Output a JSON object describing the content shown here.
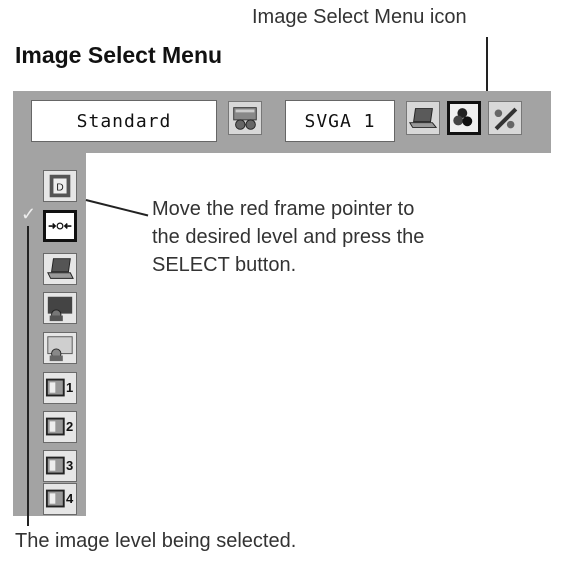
{
  "callouts": {
    "menu_icon": "Image Select Menu icon",
    "instruction_lines": [
      "Move the red frame pointer to",
      "the desired level and press the",
      "SELECT button."
    ],
    "level_selected": "The image level being selected."
  },
  "section_title": "Image Select Menu",
  "toolbar": {
    "mode_label": "Standard",
    "signal_label": "SVGA 1",
    "icons": [
      "projector-settings-icon",
      "laptop-icon",
      "image-select-icon",
      "pen-icon"
    ],
    "selected_icon": "image-select-icon"
  },
  "levels": [
    {
      "name": "dynamic",
      "icon": "document-d-icon"
    },
    {
      "name": "standard",
      "icon": "arrows-center-icon"
    },
    {
      "name": "real",
      "icon": "laptop-icon"
    },
    {
      "name": "cinema",
      "icon": "cinema-icon"
    },
    {
      "name": "blackboard",
      "icon": "blackboard-icon"
    },
    {
      "name": "image-1",
      "label": "1"
    },
    {
      "name": "image-2",
      "label": "2"
    },
    {
      "name": "image-3",
      "label": "3"
    },
    {
      "name": "image-4",
      "label": "4"
    }
  ],
  "selected_level": "standard",
  "colors": {
    "menu_background": "#a3a3a3",
    "box_background": "#ffffff"
  }
}
